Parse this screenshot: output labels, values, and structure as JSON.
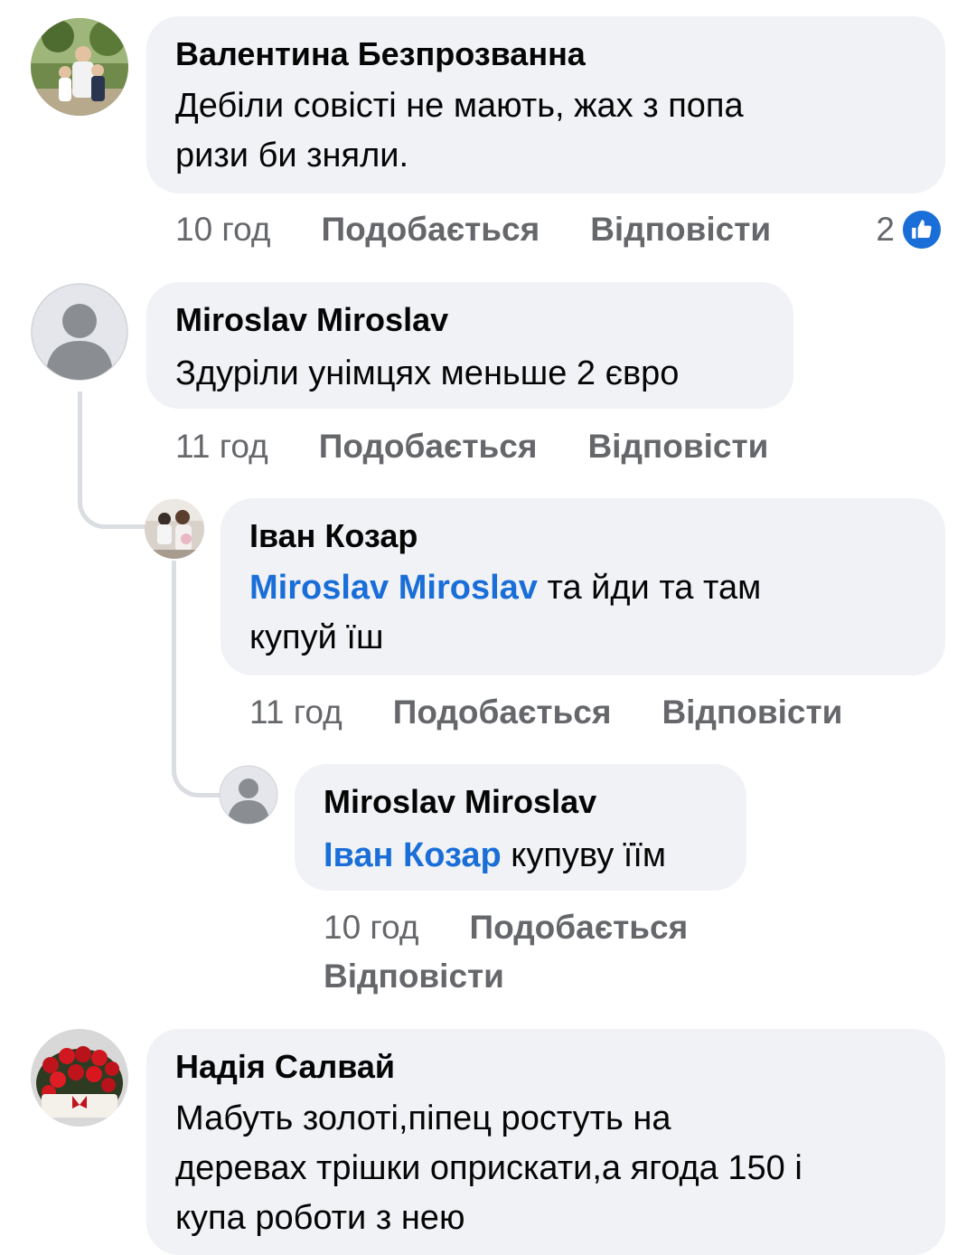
{
  "comments": [
    {
      "author": "Валентина Безпрозванна",
      "text_line1": "Дебіли совісті не мають, жах з попа",
      "text_line2": "ризи би зняли.",
      "time": "10 год",
      "like_label": "Подобається",
      "reply_label": "Відповісти",
      "reaction_count": "2",
      "reaction_icon": "like-icon",
      "avatar": "photo-avatar"
    },
    {
      "author": "Miroslav Miroslav",
      "text": "Здуріли унімцях меньше 2 євро",
      "time": "11 год",
      "like_label": "Подобається",
      "reply_label": "Відповісти",
      "avatar": "default-user-avatar"
    },
    {
      "author": "Іван Козар",
      "mention": "Miroslav Miroslav",
      "text_line1": " та йди та там",
      "text_line2": "купуй їш",
      "time": "11 год",
      "like_label": "Подобається",
      "reply_label": "Відповісти",
      "avatar": "photo-avatar"
    },
    {
      "author": "Miroslav Miroslav",
      "mention": "Іван Козар",
      "text": " купуву їїм",
      "time": "10 год",
      "like_label": "Подобається",
      "reply_label": "Відповісти",
      "avatar": "default-user-avatar"
    },
    {
      "author": "Надія Салвай",
      "text_line1": "Мабуть золоті,піпец ростуть на",
      "text_line2": "деревах трішки оприскати,а ягода 150 і",
      "text_line3": "купа роботи з нею",
      "avatar": "roses-avatar"
    }
  ],
  "colors": {
    "bubble": "#f0f2f5",
    "mention": "#1a6ed8",
    "meta": "#65676b",
    "thread_line": "#dadde1"
  }
}
